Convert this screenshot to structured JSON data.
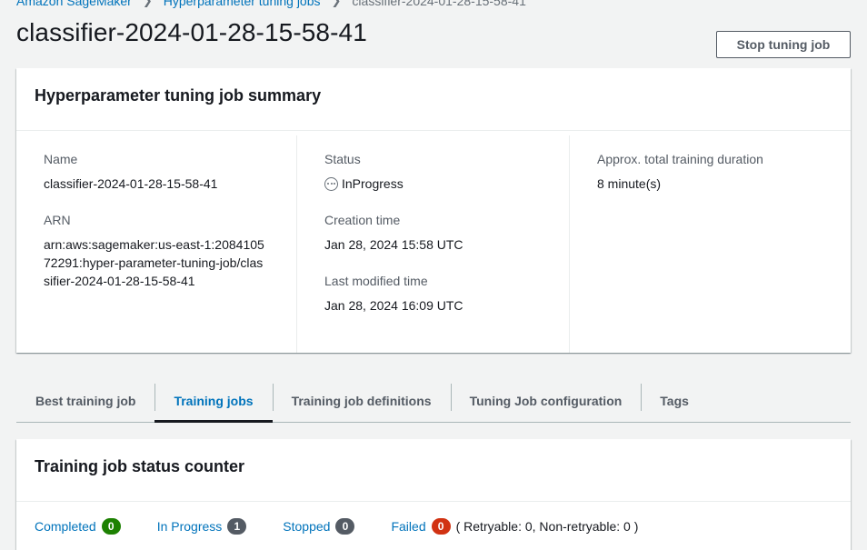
{
  "breadcrumb": {
    "items": [
      "Amazon SageMaker",
      "Hyperparameter tuning jobs"
    ],
    "current": "classifier-2024-01-28-15-58-41"
  },
  "page": {
    "title": "classifier-2024-01-28-15-58-41",
    "stop_button": "Stop tuning job"
  },
  "summary": {
    "heading": "Hyperparameter tuning job summary",
    "name_label": "Name",
    "name_value": "classifier-2024-01-28-15-58-41",
    "arn_label": "ARN",
    "arn_value": "arn:aws:sagemaker:us-east-1:208410572291:hyper-parameter-tuning-job/classifier-2024-01-28-15-58-41",
    "status_label": "Status",
    "status_value": "InProgress",
    "status_icon": "in-progress-icon",
    "creation_label": "Creation time",
    "creation_value": "Jan 28, 2024 15:58 UTC",
    "modified_label": "Last modified time",
    "modified_value": "Jan 28, 2024 16:09 UTC",
    "duration_label": "Approx. total training duration",
    "duration_value": "8 minute(s)"
  },
  "tabs": [
    {
      "label": "Best training job",
      "active": false
    },
    {
      "label": "Training jobs",
      "active": true
    },
    {
      "label": "Training job definitions",
      "active": false
    },
    {
      "label": "Tuning Job configuration",
      "active": false
    },
    {
      "label": "Tags",
      "active": false
    }
  ],
  "counter": {
    "heading": "Training job status counter",
    "items": [
      {
        "label": "Completed",
        "count": "0",
        "color": "#1d8102"
      },
      {
        "label": "In Progress",
        "count": "1",
        "color": "#545b64"
      },
      {
        "label": "Stopped",
        "count": "0",
        "color": "#545b64"
      },
      {
        "label": "Failed",
        "count": "0",
        "color": "#d13212"
      }
    ],
    "retry_text": "( Retryable: 0, Non-retryable: 0 )"
  },
  "colors": {
    "link": "#0073bb",
    "background": "#f2f3f3",
    "text": "#16191f"
  }
}
